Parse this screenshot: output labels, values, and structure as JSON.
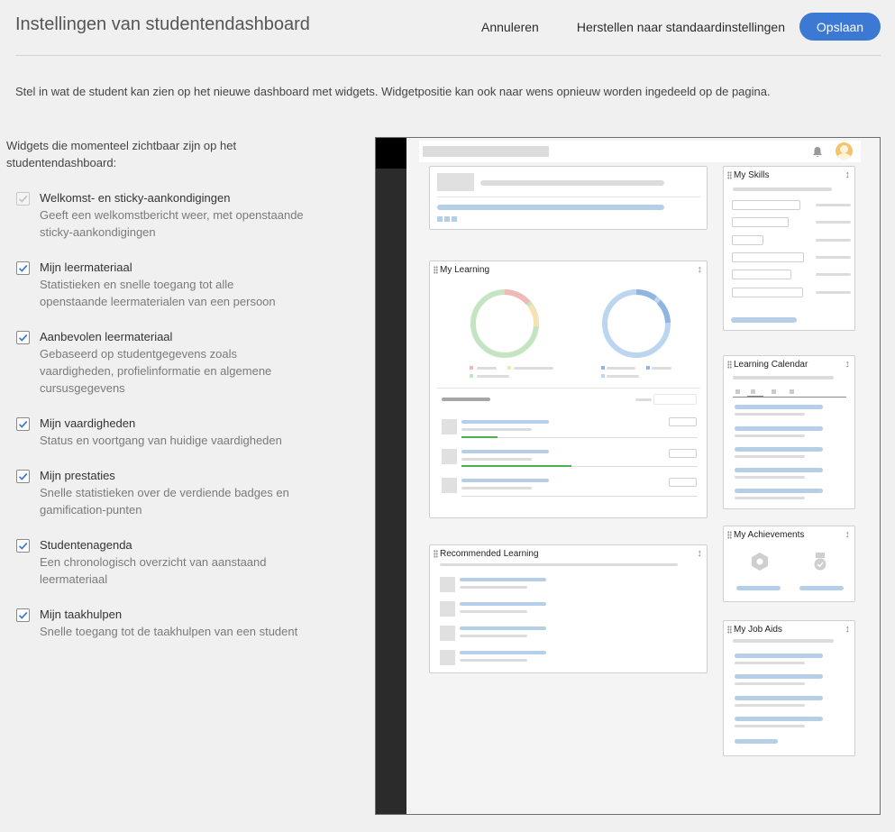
{
  "header": {
    "title": "Instellingen van studentendashboard",
    "cancel_label": "Annuleren",
    "reset_label": "Herstellen naar standaardinstellingen",
    "save_label": "Opslaan"
  },
  "intro": "Stel in wat de student kan zien op het nieuwe dashboard met widgets. Widgetpositie kan ook naar wens opnieuw worden ingedeeld op de pagina.",
  "widgets": {
    "heading": "Widgets die momenteel zichtbaar zijn op het studentendashboard:",
    "items": [
      {
        "title": "Welkomst- en sticky-aankondigingen",
        "desc": "Geeft een welkomstbericht weer, met openstaande sticky-aankondigingen",
        "checked": true,
        "disabled": true
      },
      {
        "title": "Mijn leermateriaal",
        "desc": "Statistieken en snelle toegang tot alle openstaande leermaterialen van een persoon",
        "checked": true,
        "disabled": false
      },
      {
        "title": "Aanbevolen leermateriaal",
        "desc": "Gebaseerd op studentgegevens zoals vaardigheden, profielinformatie en algemene cursusgegevens",
        "checked": true,
        "disabled": false
      },
      {
        "title": "Mijn vaardigheden",
        "desc": "Status en voortgang van huidige vaardigheden",
        "checked": true,
        "disabled": false
      },
      {
        "title": "Mijn prestaties",
        "desc": "Snelle statistieken over de verdiende badges en gamification-punten",
        "checked": true,
        "disabled": false
      },
      {
        "title": "Studentenagenda",
        "desc": "Een chronologisch overzicht van aanstaand leermateriaal",
        "checked": true,
        "disabled": false
      },
      {
        "title": "Mijn taakhulpen",
        "desc": "Snelle toegang tot de taakhulpen van een student",
        "checked": true,
        "disabled": false
      }
    ]
  },
  "preview": {
    "cards": {
      "my_skills": "My Skills",
      "my_learning": "My Learning",
      "learning_calendar": "Learning Calendar",
      "recommended_learning": "Recommended Learning",
      "my_achievements": "My Achievements",
      "my_job_aids": "My Job Aids"
    },
    "icons": {
      "bell": "bell-icon",
      "avatar": "avatar",
      "resize": "resize-icon",
      "grip": "drag-handle-icon"
    }
  },
  "colors": {
    "accent": "#3b79d4",
    "check": "#3b79d4",
    "placeholder_blue": "#b5cfe8",
    "placeholder_gray": "#dcdcdc"
  }
}
